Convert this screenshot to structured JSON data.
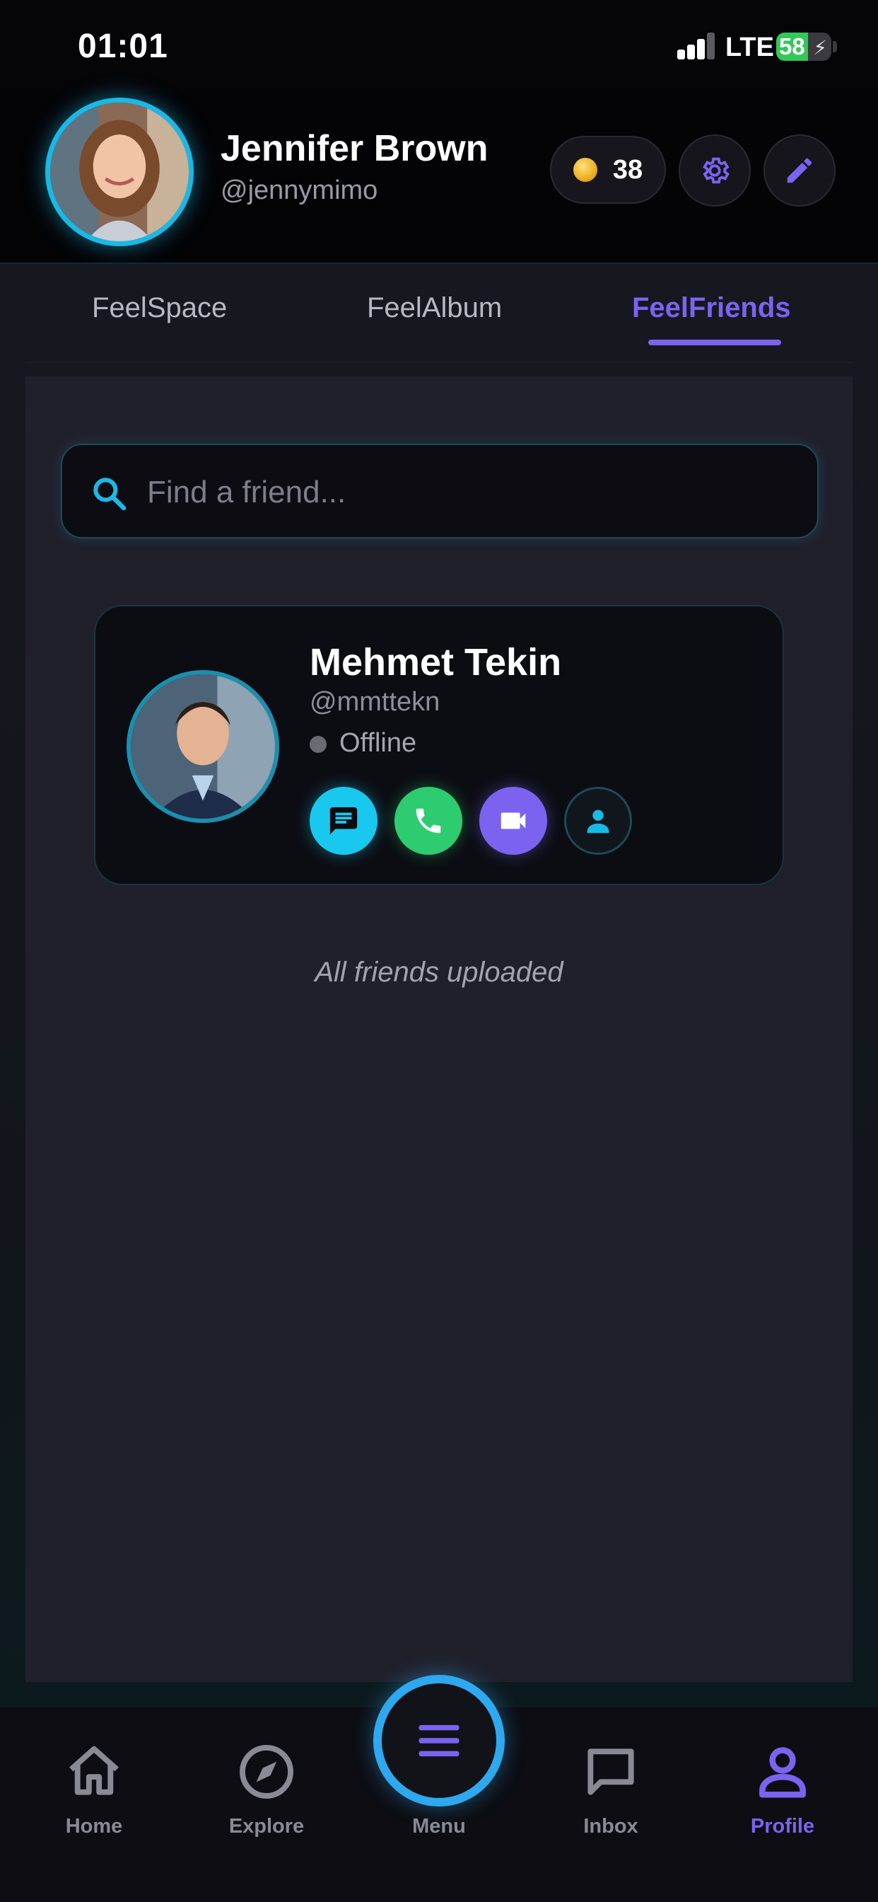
{
  "status_bar": {
    "time": "01:01",
    "network": "LTE",
    "battery": "58",
    "battery_level": 0.58
  },
  "profile": {
    "name": "Jennifer Brown",
    "handle": "@jennymimo",
    "coins": "38"
  },
  "tabs": [
    {
      "label": "FeelSpace",
      "active": false
    },
    {
      "label": "FeelAlbum",
      "active": false
    },
    {
      "label": "FeelFriends",
      "active": true
    }
  ],
  "search": {
    "placeholder": "Find a friend...",
    "value": ""
  },
  "friends": [
    {
      "name": "Mehmet Tekin",
      "handle": "@mmttekn",
      "status": "Offline"
    }
  ],
  "list_end_text": "All friends uploaded",
  "bottom_nav": [
    {
      "label": "Home",
      "icon": "home-icon",
      "active": false
    },
    {
      "label": "Explore",
      "icon": "compass-icon",
      "active": false
    },
    {
      "label": "Menu",
      "icon": "menu-icon",
      "active": false
    },
    {
      "label": "Inbox",
      "icon": "chat-bubble-icon",
      "active": false
    },
    {
      "label": "Profile",
      "icon": "person-icon",
      "active": true
    }
  ],
  "colors": {
    "accent": "#7b63f0",
    "cyan": "#19b9e6",
    "call": "#2ecc71",
    "video": "#7b63f0",
    "background": "#20202b"
  }
}
